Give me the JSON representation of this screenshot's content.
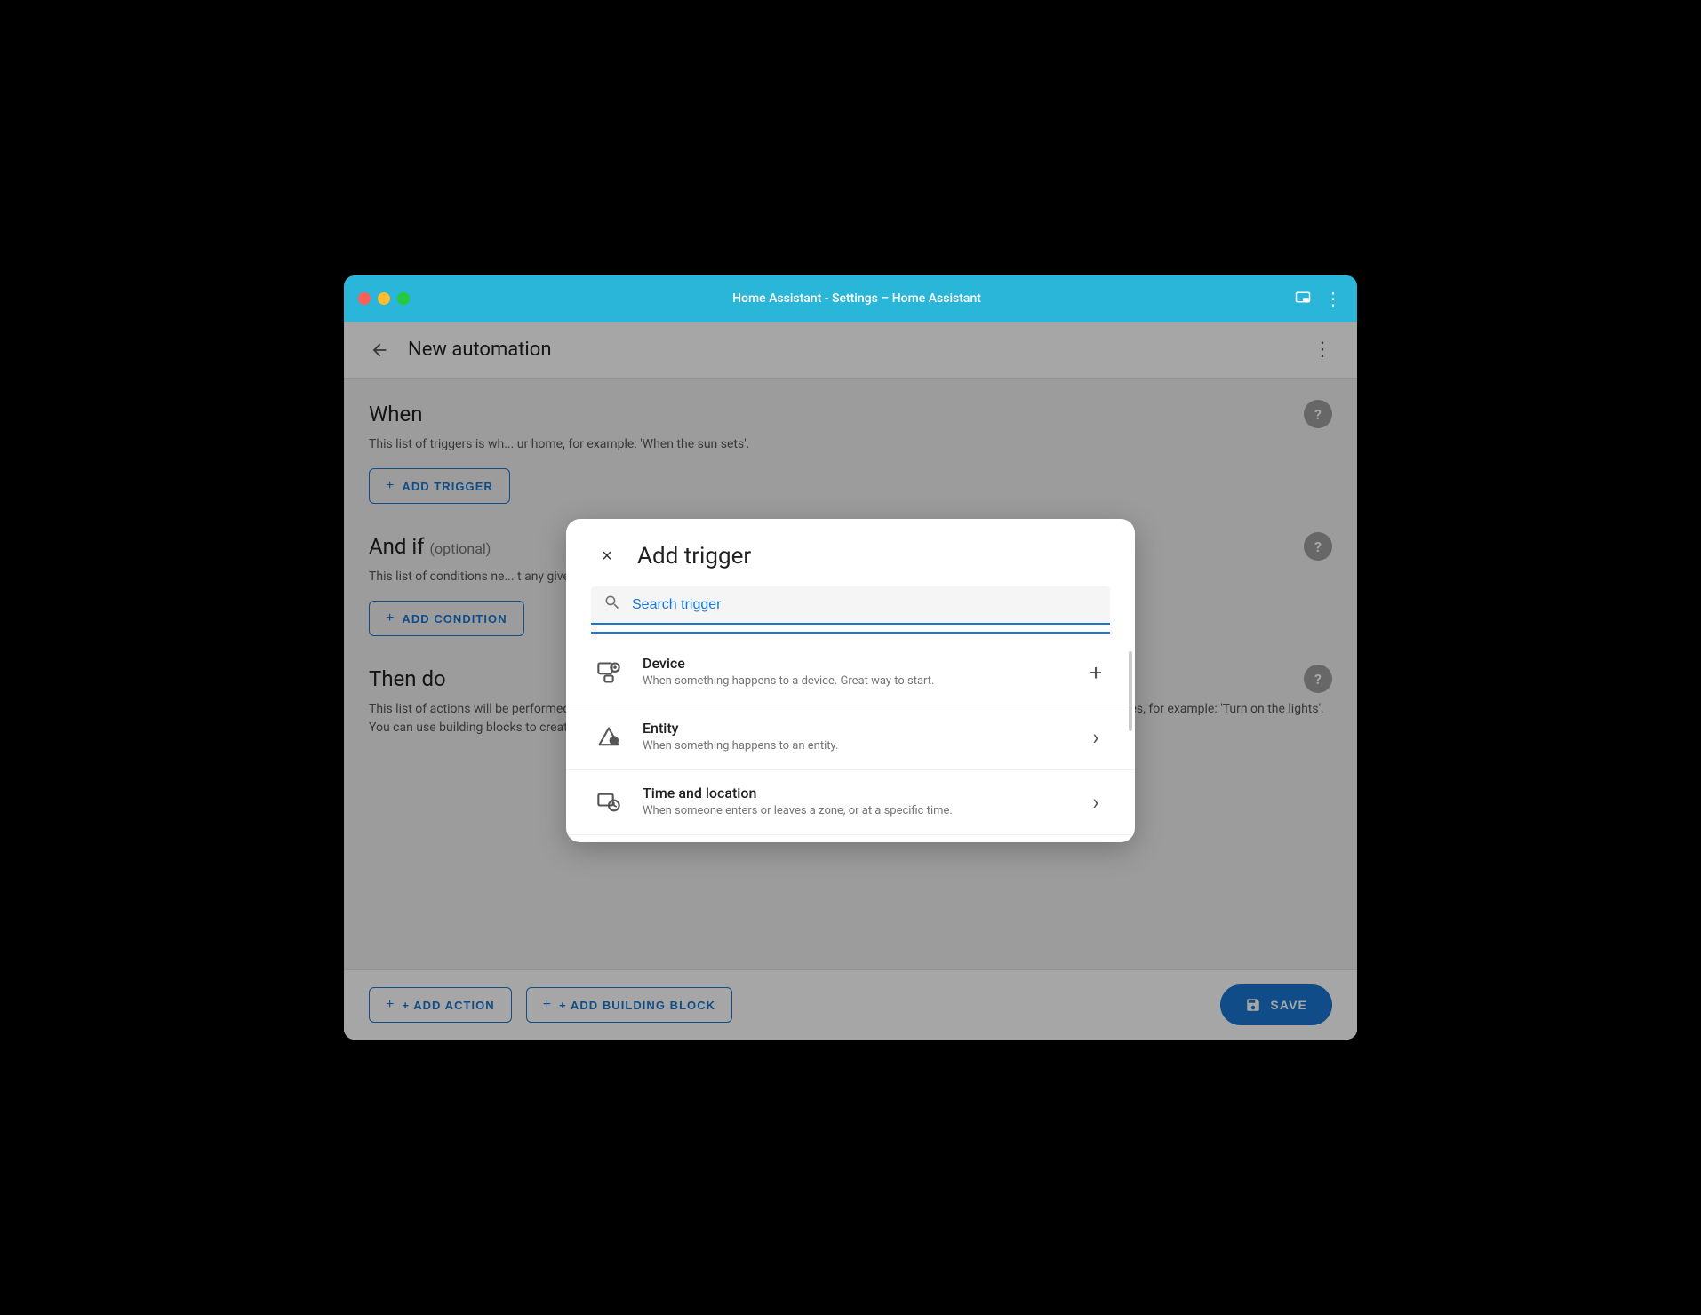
{
  "window": {
    "titlebar": {
      "title": "Home Assistant - Settings – Home Assistant"
    },
    "header": {
      "page_title": "New automation",
      "back_label": "←",
      "more_label": "⋮"
    }
  },
  "sections": {
    "when": {
      "title": "When",
      "description": "This list of triggers is wh... ur home, for example: 'When the sun sets'.",
      "add_trigger_label": "+ ADD TRIGGER",
      "help": "?"
    },
    "and_if": {
      "title": "And if",
      "optional_label": "(optional)",
      "description": "This list of conditions ne... t any given time, for example: 'If Frenck is ho...",
      "add_condition_label": "+ ADD CONDITION",
      "help": "?"
    },
    "then_do": {
      "title": "Then do",
      "description": "This list of actions will be performed in sequence when the automation runs. An action usually controls one of your areas, devices, or entities, for example: 'Turn on the lights'. You can use building blocks to create more complex sequences of actions.",
      "add_action_label": "+ ADD ACTION",
      "add_block_label": "+ ADD BUILDING BLOCK",
      "help": "?"
    }
  },
  "dialog": {
    "title": "Add trigger",
    "close_icon": "×",
    "search_placeholder": "Search trigger",
    "items": [
      {
        "name": "Device",
        "description": "When something happens to a device. Great way to start.",
        "icon_type": "device",
        "action": "+"
      },
      {
        "name": "Entity",
        "description": "When something happens to an entity.",
        "icon_type": "entity",
        "action": "›"
      },
      {
        "name": "Time and location",
        "description": "When someone enters or leaves a zone, or at a specific time.",
        "icon_type": "time",
        "action": "›"
      }
    ]
  },
  "bottom_bar": {
    "save_label": "SAVE"
  }
}
